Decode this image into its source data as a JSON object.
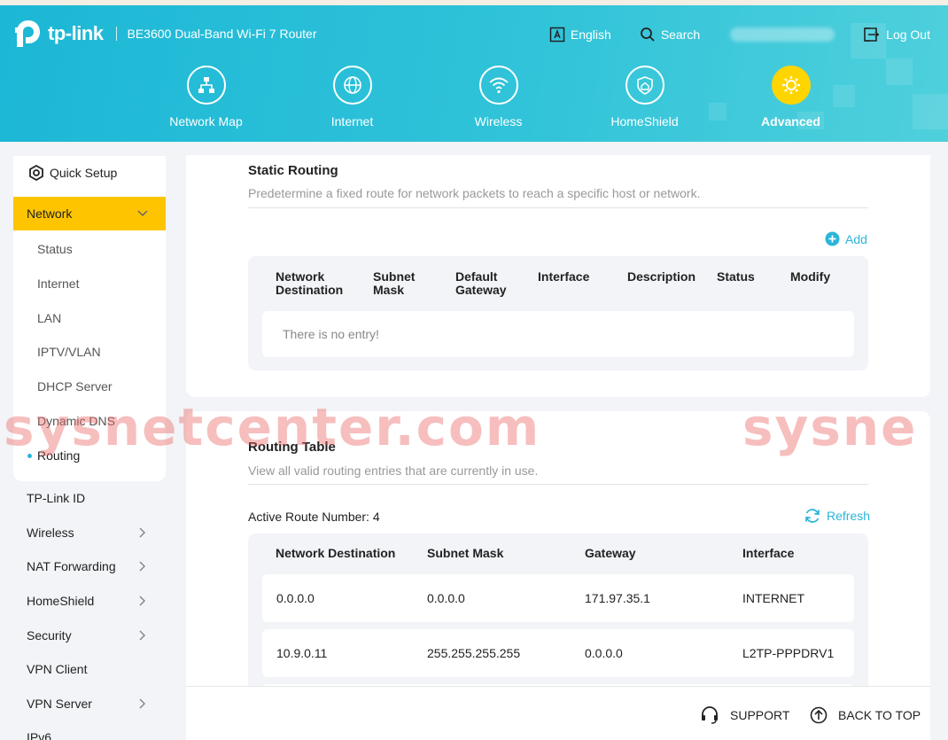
{
  "header": {
    "brand": "tp-link",
    "model": "BE3600 Dual-Band Wi-Fi 7 Router",
    "language": "English",
    "search": "Search",
    "logout": "Log Out",
    "language_icon": "language-icon",
    "search_icon": "search-icon",
    "logout_icon": "logout-icon"
  },
  "mainnav": [
    {
      "label": "Network Map",
      "icon": "network-map-icon",
      "active": false
    },
    {
      "label": "Internet",
      "icon": "globe-icon",
      "active": false
    },
    {
      "label": "Wireless",
      "icon": "wifi-icon",
      "active": false
    },
    {
      "label": "HomeShield",
      "icon": "homeshield-icon",
      "active": false
    },
    {
      "label": "Advanced",
      "icon": "gear-icon",
      "active": true
    }
  ],
  "sidebar": {
    "quick_setup": "Quick Setup",
    "network": "Network",
    "network_sub": [
      "Status",
      "Internet",
      "LAN",
      "IPTV/VLAN",
      "DHCP Server",
      "Dynamic DNS",
      "Routing"
    ],
    "active_sub": "Routing",
    "items": [
      {
        "label": "TP-Link ID",
        "chevron": false
      },
      {
        "label": "Wireless",
        "chevron": true
      },
      {
        "label": "NAT Forwarding",
        "chevron": true
      },
      {
        "label": "HomeShield",
        "chevron": true
      },
      {
        "label": "Security",
        "chevron": true
      },
      {
        "label": "VPN Client",
        "chevron": false
      },
      {
        "label": "VPN Server",
        "chevron": true
      },
      {
        "label": "IPv6",
        "chevron": false
      }
    ]
  },
  "static_routing": {
    "title": "Static Routing",
    "description": "Predetermine a fixed route for network packets to reach a specific host or network.",
    "add": "Add",
    "headers": [
      [
        "Network",
        "Destination"
      ],
      [
        "Subnet",
        "Mask"
      ],
      [
        "Default",
        "Gateway"
      ],
      [
        "Interface"
      ],
      [
        "Description"
      ],
      [
        "Status"
      ],
      [
        "Modify"
      ]
    ],
    "empty": "There is no entry!"
  },
  "routing_table": {
    "title": "Routing Table",
    "description": "View all valid routing entries that are currently in use.",
    "active_label": "Active Route Number: 4",
    "refresh": "Refresh",
    "headers": [
      "Network Destination",
      "Subnet Mask",
      "Gateway",
      "Interface"
    ],
    "rows": [
      [
        "0.0.0.0",
        "0.0.0.0",
        "171.97.35.1",
        "INTERNET"
      ],
      [
        "10.9.0.11",
        "255.255.255.255",
        "0.0.0.0",
        "L2TP-PPPDRV1"
      ]
    ]
  },
  "footer": {
    "support": "SUPPORT",
    "back_to_top": "BACK TO TOP"
  },
  "watermark": {
    "left": "sysnetcenter.com",
    "right": "sysne"
  },
  "colors": {
    "accent": "#2bb5d8",
    "active_menu": "#ffc400",
    "header": "#1cb7d6",
    "advanced": "#ffd500"
  }
}
